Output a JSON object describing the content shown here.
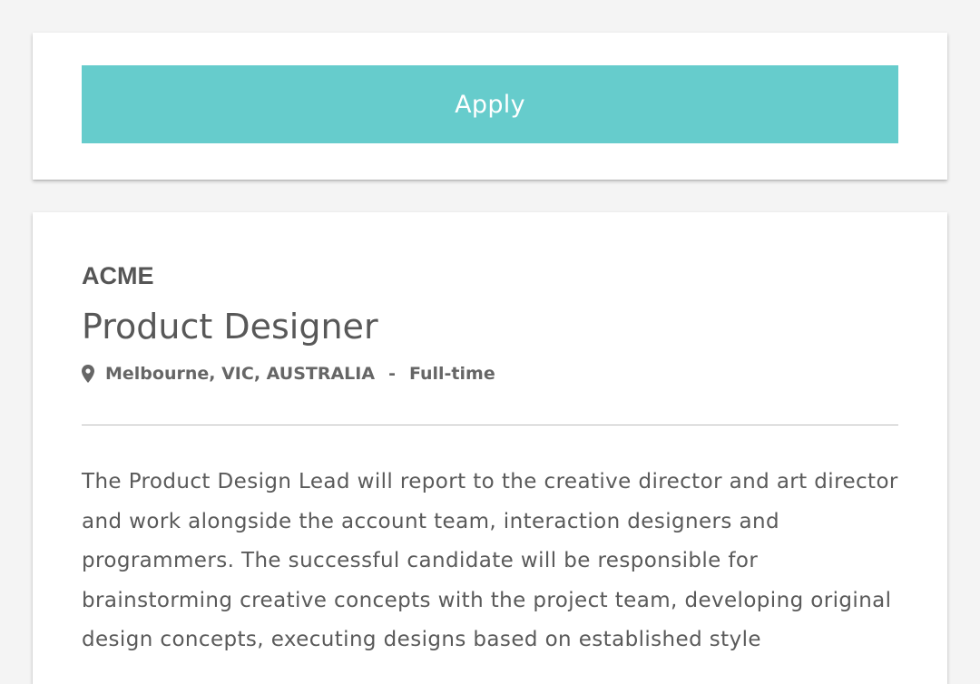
{
  "colors": {
    "accent": "#66cccc",
    "page_background": "#f4f4f4",
    "card_background": "#ffffff",
    "text": "#555555"
  },
  "apply_card": {
    "apply_label": "Apply"
  },
  "job": {
    "company": "ACME",
    "title": "Product Designer",
    "location_icon": "map-pin-icon",
    "location": "Melbourne, VIC, AUSTRALIA",
    "separator": "-",
    "employment_type": "Full-time",
    "description": "The Product Design Lead will report to the creative director and art director and work alongside the account team, interaction designers and programmers. The successful candidate will be responsible for brainstorming creative concepts with the project team, developing original design concepts, executing designs based on established style"
  }
}
